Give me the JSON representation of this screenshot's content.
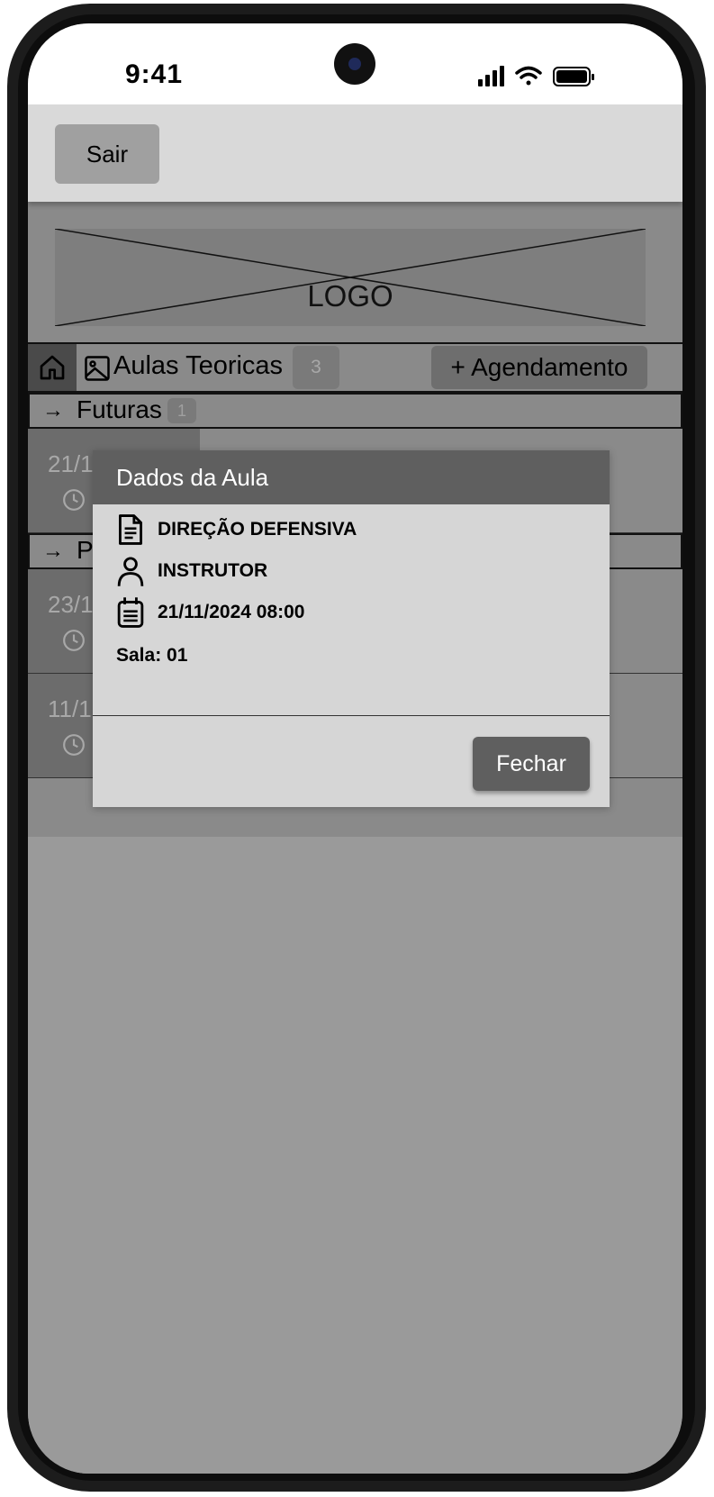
{
  "status_bar": {
    "time": "9:41"
  },
  "header": {
    "logout_label": "Sair"
  },
  "logo": {
    "text": "LOGO"
  },
  "tabbar": {
    "title": "Aulas Teoricas",
    "count": "3",
    "schedule_label": "+ Agendamento"
  },
  "sections": {
    "future": {
      "label": "Futuras",
      "count": "1"
    },
    "past": {
      "label": "P"
    }
  },
  "rows": [
    {
      "date": "21/1"
    },
    {
      "date": "23/1"
    },
    {
      "date": "11/1"
    }
  ],
  "modal": {
    "title": "Dados da Aula",
    "course": "DIREÇÃO DEFENSIVA",
    "instructor": "INSTRUTOR",
    "datetime": "21/11/2024 08:00",
    "room": "Sala: 01",
    "close_label": "Fechar"
  },
  "icons": {
    "home": "home-icon",
    "image": "image-icon",
    "arrow": "arrow-right-icon",
    "clock": "clock-icon",
    "document": "document-icon",
    "user": "user-icon",
    "calendar": "calendar-icon"
  },
  "colors": {
    "modal_header": "#5f5f5f",
    "topbar": "#d9d9d9",
    "overlay": "#9a9a9a"
  }
}
